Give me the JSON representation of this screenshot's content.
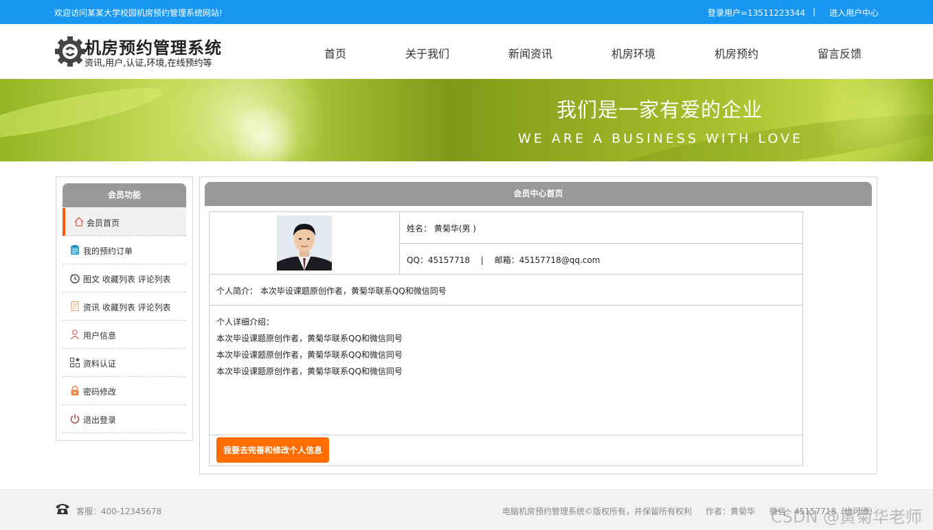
{
  "topbar": {
    "welcome": "欢迎访问某某大学校园机房预约管理系统网站!",
    "login_user": "登录用户=13511223344",
    "separator": "|",
    "user_center": "进入用户中心"
  },
  "header": {
    "logo_icon": "gear-logo-icon",
    "title": "机房预约管理系统",
    "subtitle": "资讯,用户,认证,环境,在线预约等",
    "nav": [
      "首页",
      "关于我们",
      "新闻资讯",
      "机房环境",
      "机房预约",
      "留言反馈"
    ]
  },
  "banner": {
    "cn_text": "我们是一家有爱的企业",
    "en_text": "WE ARE A BUSINESS WITH LOVE"
  },
  "sidebar": {
    "title": "会员功能",
    "items": [
      {
        "label": "会员首页",
        "icon": "home-icon",
        "active": true
      },
      {
        "label": "我的预约订单",
        "icon": "clipboard-icon"
      },
      {
        "label": "图文 收藏列表 评论列表",
        "icon": "clock-icon"
      },
      {
        "label": "资讯 收藏列表 评论列表",
        "icon": "document-icon"
      },
      {
        "label": "用户信息",
        "icon": "user-icon"
      },
      {
        "label": "资料认证",
        "icon": "grid-icon"
      },
      {
        "label": "密码修改",
        "icon": "lock-icon"
      },
      {
        "label": "退出登录",
        "icon": "power-icon"
      }
    ]
  },
  "main": {
    "title": "会员中心首页",
    "photo_icon": "avatar-photo",
    "name_line": "姓名： 黄菊华(男 )",
    "qq_line": "QQ：45157718　  |　  邮箱：45157718@qq.com",
    "intro_line": "个人简介：  本次毕设课题原创作者，黄菊华联系QQ和微信同号",
    "detail_title": "个人详细介绍：",
    "detail_lines": [
      "本次毕设课题原创作者，黄菊华联系QQ和微信同号",
      "本次毕设课题原创作者，黄菊华联系QQ和微信同号",
      "本次毕设课题原创作者，黄菊华联系QQ和微信同号"
    ],
    "edit_button": "我要去完善和修改个人信息"
  },
  "footer": {
    "phone_icon": "phone-icon",
    "service": "客服：400-12345678",
    "copyright": "电脑机房预约管理系统©版权所有，并保留所有权利",
    "author": "作者：黄菊华",
    "wechat": "微信：45157718（也可添）"
  },
  "watermark": "CSDN @黄菊华老师",
  "colors": {
    "topbar": "#1996f0",
    "accent": "#ff6c00",
    "panel_head": "#999999"
  }
}
